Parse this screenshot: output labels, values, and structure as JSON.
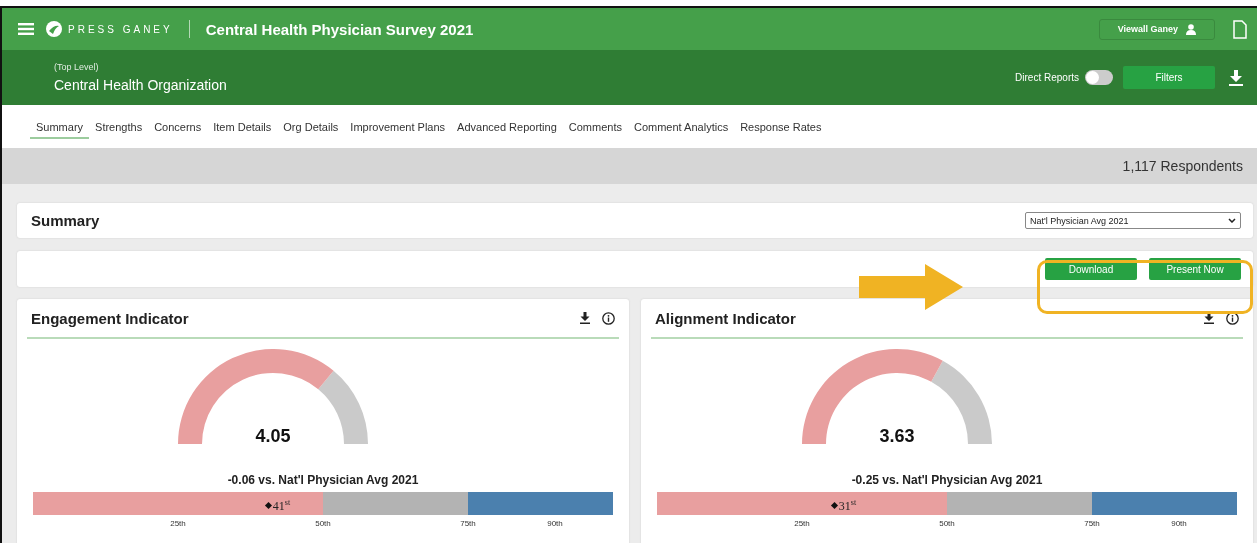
{
  "app": {
    "brand": "PRESS GANEY",
    "title": "Central Health Physician Survey 2021",
    "user": "Viewall Ganey"
  },
  "org": {
    "level": "(Top Level)",
    "name": "Central Health Organization",
    "direct_reports": {
      "label": "Direct Reports",
      "on": false
    },
    "filters": "Filters"
  },
  "tabs": [
    {
      "label": "Summary",
      "selected": true
    },
    {
      "label": "Strengths",
      "selected": false
    },
    {
      "label": "Concerns",
      "selected": false
    },
    {
      "label": "Item Details",
      "selected": false
    },
    {
      "label": "Org Details",
      "selected": false
    },
    {
      "label": "Improvement Plans",
      "selected": false
    },
    {
      "label": "Advanced Reporting",
      "selected": false
    },
    {
      "label": "Comments",
      "selected": false
    },
    {
      "label": "Comment Analytics",
      "selected": false
    },
    {
      "label": "Response Rates",
      "selected": false
    }
  ],
  "respondents": "1,117 Respondents",
  "summary": {
    "title": "Summary",
    "benchmark": "Nat'l Physician Avg 2021"
  },
  "actions": [
    "Download",
    "Present Now"
  ],
  "indicators": [
    {
      "title": "Engagement Indicator",
      "score": "4.05",
      "comparison": "-0.06 vs. Nat'l Physician Avg 2021",
      "percentile_bar": {
        "marker": "41$^{st}$",
        "ticks": [
          "25th",
          "50th",
          "75th",
          "90th"
        ]
      }
    },
    {
      "title": "Alignment Indicator",
      "score": "3.63",
      "comparison": "-0.25 vs. Nat'l Physician Avg 2021",
      "percentile_bar": {
        "marker": "31$^{st}$",
        "ticks": [
          "25th",
          "50th",
          "75th",
          "90th"
        ]
      }
    }
  ]
}
